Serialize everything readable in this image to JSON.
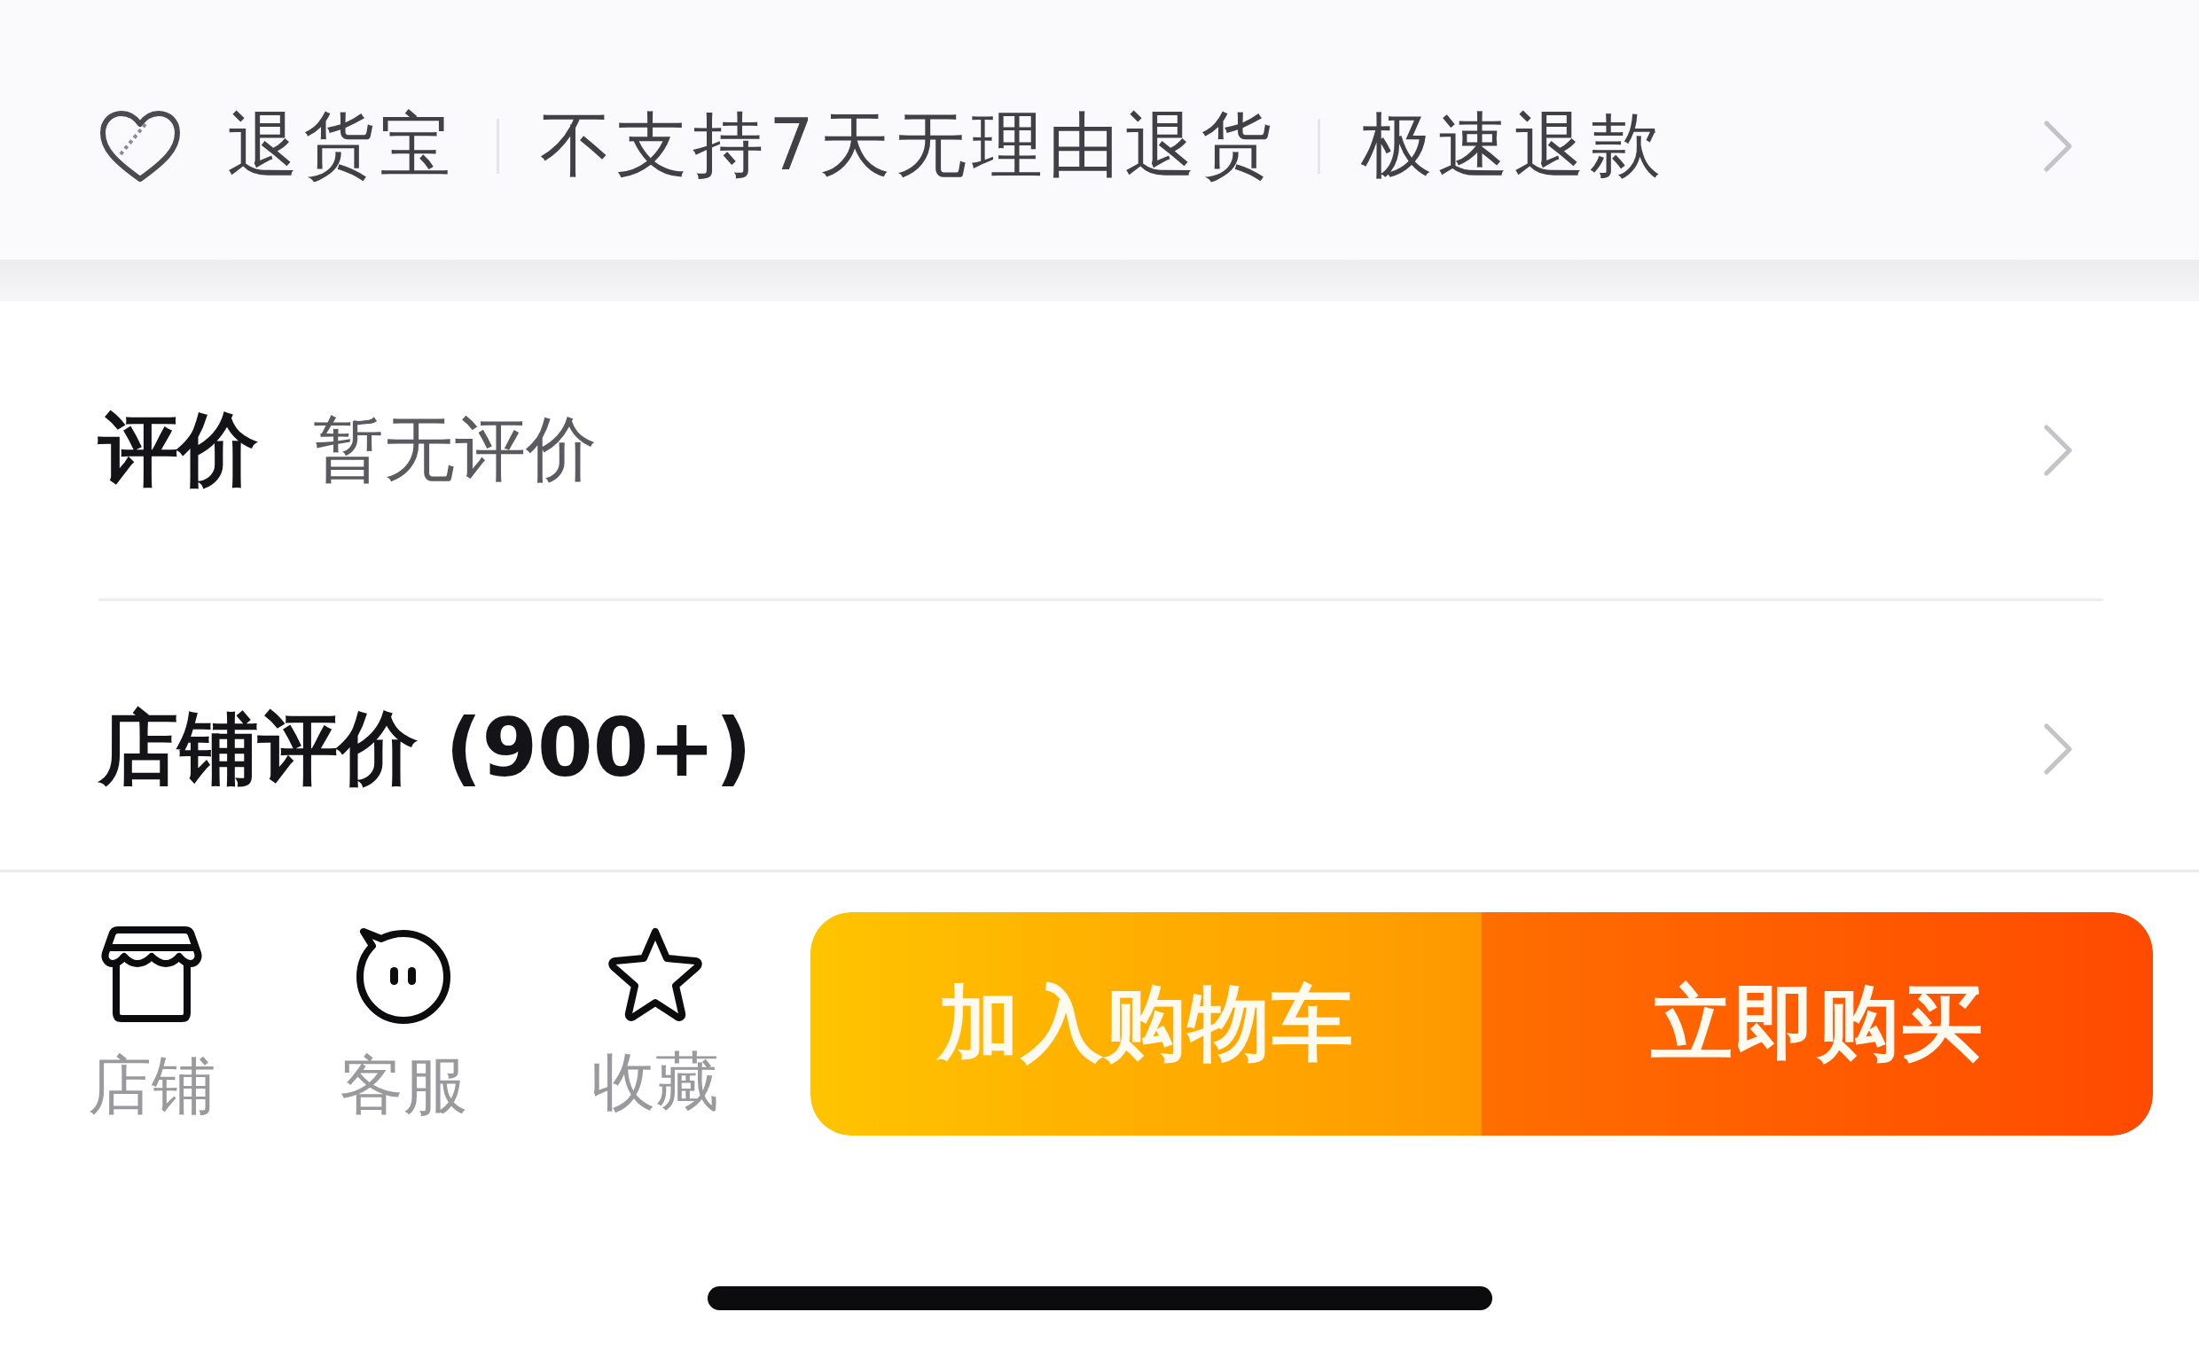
{
  "service_bar": {
    "items": [
      "退货宝",
      "不支持7天无理由退货",
      "极速退款"
    ]
  },
  "reviews": {
    "label": "评价",
    "summary": "暂无评价"
  },
  "shop_reviews": {
    "label": "店铺评价 (900+)"
  },
  "bottom_bar": {
    "actions": [
      {
        "kind": "shop",
        "label": "店铺"
      },
      {
        "kind": "service",
        "label": "客服"
      },
      {
        "kind": "favorite",
        "label": "收藏"
      }
    ],
    "buttons": [
      {
        "kind": "cart",
        "label": "加入购物车"
      },
      {
        "kind": "buy",
        "label": "立即购买"
      }
    ]
  }
}
